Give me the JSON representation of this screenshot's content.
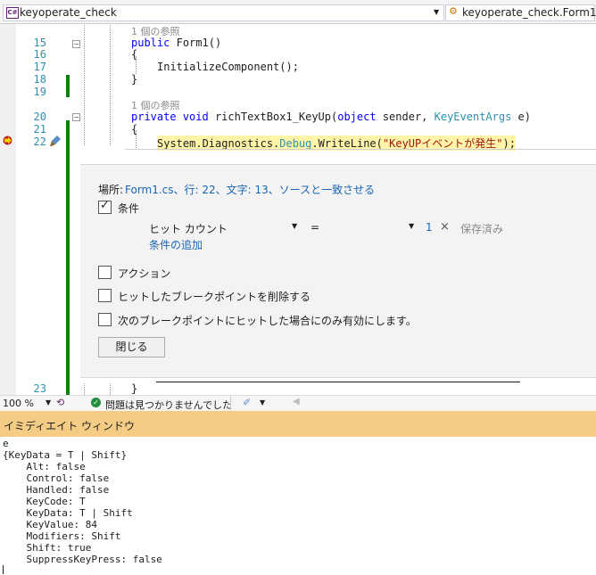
{
  "nav": {
    "project": "keyoperate_check",
    "class_member": "keyoperate_check.Form1"
  },
  "editor": {
    "line_numbers": [
      "15",
      "16",
      "17",
      "18",
      "19",
      "20",
      "21",
      "22",
      "23"
    ],
    "ref1": "1 個の参照",
    "line15_kw": "public",
    "line15_name": "Form1()",
    "brace_open": "{",
    "brace_close": "}",
    "line17": "InitializeComponent();",
    "ref2": "1 個の参照",
    "line20_kw1": "private",
    "line20_kw2": "void",
    "line20_name": "richTextBox1_KeyUp(",
    "line20_kw3": "object",
    "line20_p1": " sender, ",
    "line20_ty": "KeyEventArgs",
    "line20_p2": " e)",
    "line22_a": "System",
    "line22_b": ".Diagnostics.",
    "line22_c": "Debug",
    "line22_d": ".WriteLine(",
    "line22_str": "\"KeyUPイベントが発生\"",
    "line22_e": ");"
  },
  "breakpoint": {
    "location_label": "場所:",
    "location_link": "Form1.cs、行: 22、文字: 13、ソースと一致させる",
    "conditions_label": "条件",
    "conditions_checked": true,
    "condition_type": "ヒット カウント",
    "operator": "=",
    "value": "1",
    "remove_symbol": "×",
    "saved": "保存済み",
    "add_condition": "条件の追加",
    "actions_label": "アクション",
    "remove_on_hit_label": "ヒットしたブレークポイントを削除する",
    "only_enable_label": "次のブレークポイントにヒットした場合にのみ有効にします。",
    "close_button": "閉じる"
  },
  "status": {
    "zoom": "100 %",
    "issues": "問題は見つかりませんでした"
  },
  "immediate": {
    "title": "イミディエイト ウィンドウ",
    "lines": [
      "e",
      "{KeyData = T | Shift}",
      "    Alt: false",
      "    Control: false",
      "    Handled: false",
      "    KeyCode: T",
      "    KeyData: T | Shift",
      "    KeyValue: 84",
      "    Modifiers: Shift",
      "    Shift: true",
      "    SuppressKeyPress: false"
    ]
  },
  "colors": {
    "keyword": "#0000ff",
    "type": "#2b91af",
    "string": "#a31515",
    "highlight": "#fff5a8",
    "immediate_title_bg": "#f5cc84"
  }
}
